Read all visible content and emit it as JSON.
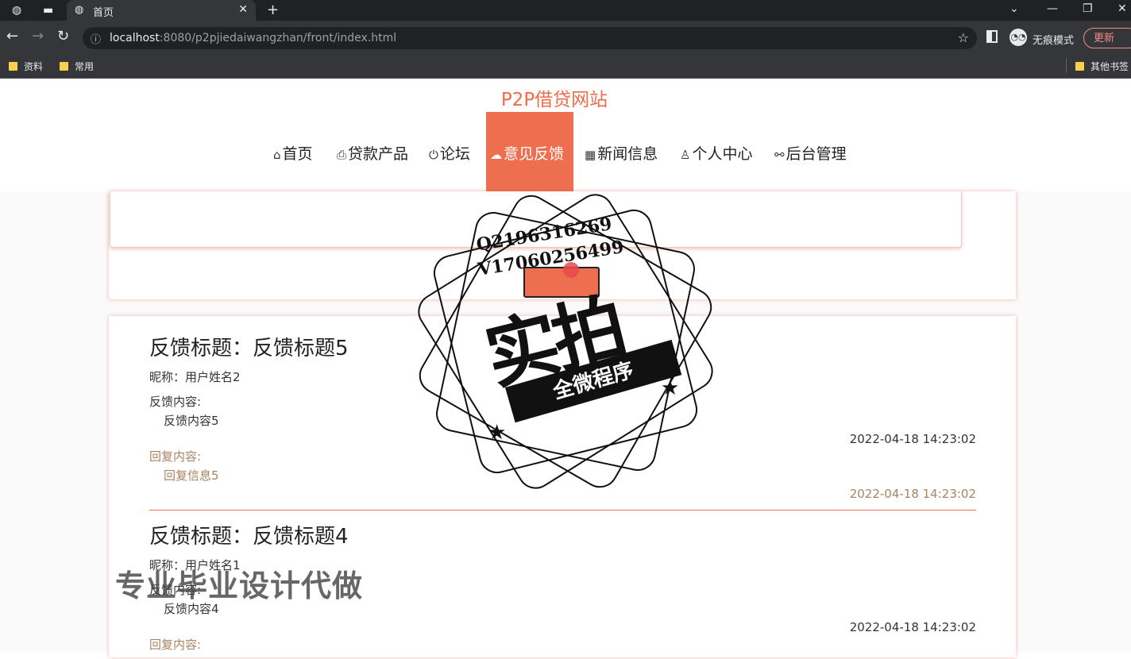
{
  "browser": {
    "tab_title": "首页",
    "url_host": "localhost",
    "url_rest": ":8080/p2pjiedaiwangzhan/front/index.html",
    "incognito_label": "无痕模式",
    "update_label": "更新",
    "bookmarks": [
      "资料",
      "常用"
    ],
    "other_bookmarks": "其他书签"
  },
  "site": {
    "title": "P2P借贷网站",
    "nav": [
      {
        "label": "首页",
        "icon": "home-icon"
      },
      {
        "label": "贷款产品",
        "icon": "printer-icon"
      },
      {
        "label": "论坛",
        "icon": "power-icon"
      },
      {
        "label": "意见反馈",
        "icon": "cloud-icon"
      },
      {
        "label": "新闻信息",
        "icon": "grid-icon"
      },
      {
        "label": "个人中心",
        "icon": "user-icon"
      },
      {
        "label": "后台管理",
        "icon": "link-icon"
      }
    ],
    "active_nav": "意见反馈"
  },
  "feedback": [
    {
      "title": "反馈标题：反馈标题5",
      "nickname": "昵称：用户姓名2",
      "content_label": "反馈内容:",
      "content": "反馈内容5",
      "content_time": "2022-04-18 14:23:02",
      "reply_label": "回复内容:",
      "reply": "回复信息5",
      "reply_time": "2022-04-18 14:23:02"
    },
    {
      "title": "反馈标题：反馈标题4",
      "nickname": "昵称：用户姓名1",
      "content_label": "反馈内容:",
      "content": "反馈内容4",
      "content_time": "2022-04-18 14:23:02",
      "reply_label": "回复内容:"
    }
  ],
  "watermark": {
    "qq": "Q2196316269",
    "vx": "V17060256499",
    "big": "实拍",
    "banner": "全微程序",
    "ad": "专业毕业设计代做"
  },
  "colors": {
    "accent": "#ee6f4f",
    "reply": "#a9845f"
  }
}
